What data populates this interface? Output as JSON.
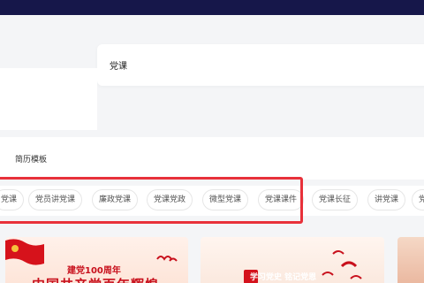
{
  "search": {
    "value": "党课"
  },
  "section": {
    "title": "简历模板"
  },
  "tags": [
    "党课",
    "党员讲党课",
    "廉政党课",
    "党课党政",
    "微型党课",
    "党课课件",
    "党课长征",
    "讲党课",
    "党"
  ],
  "cards": [
    {
      "subtitle": "建党100周年",
      "title": "中国共产党百年辉煌"
    },
    {
      "title": "学习党史 铭记党恩"
    },
    {
      "title": ""
    }
  ],
  "colors": {
    "topbar": "#16174a",
    "highlight": "#e8313a",
    "party_red": "#c8101c"
  },
  "icons": {
    "flag": "party-flag-icon",
    "birds": "dove-icon"
  }
}
